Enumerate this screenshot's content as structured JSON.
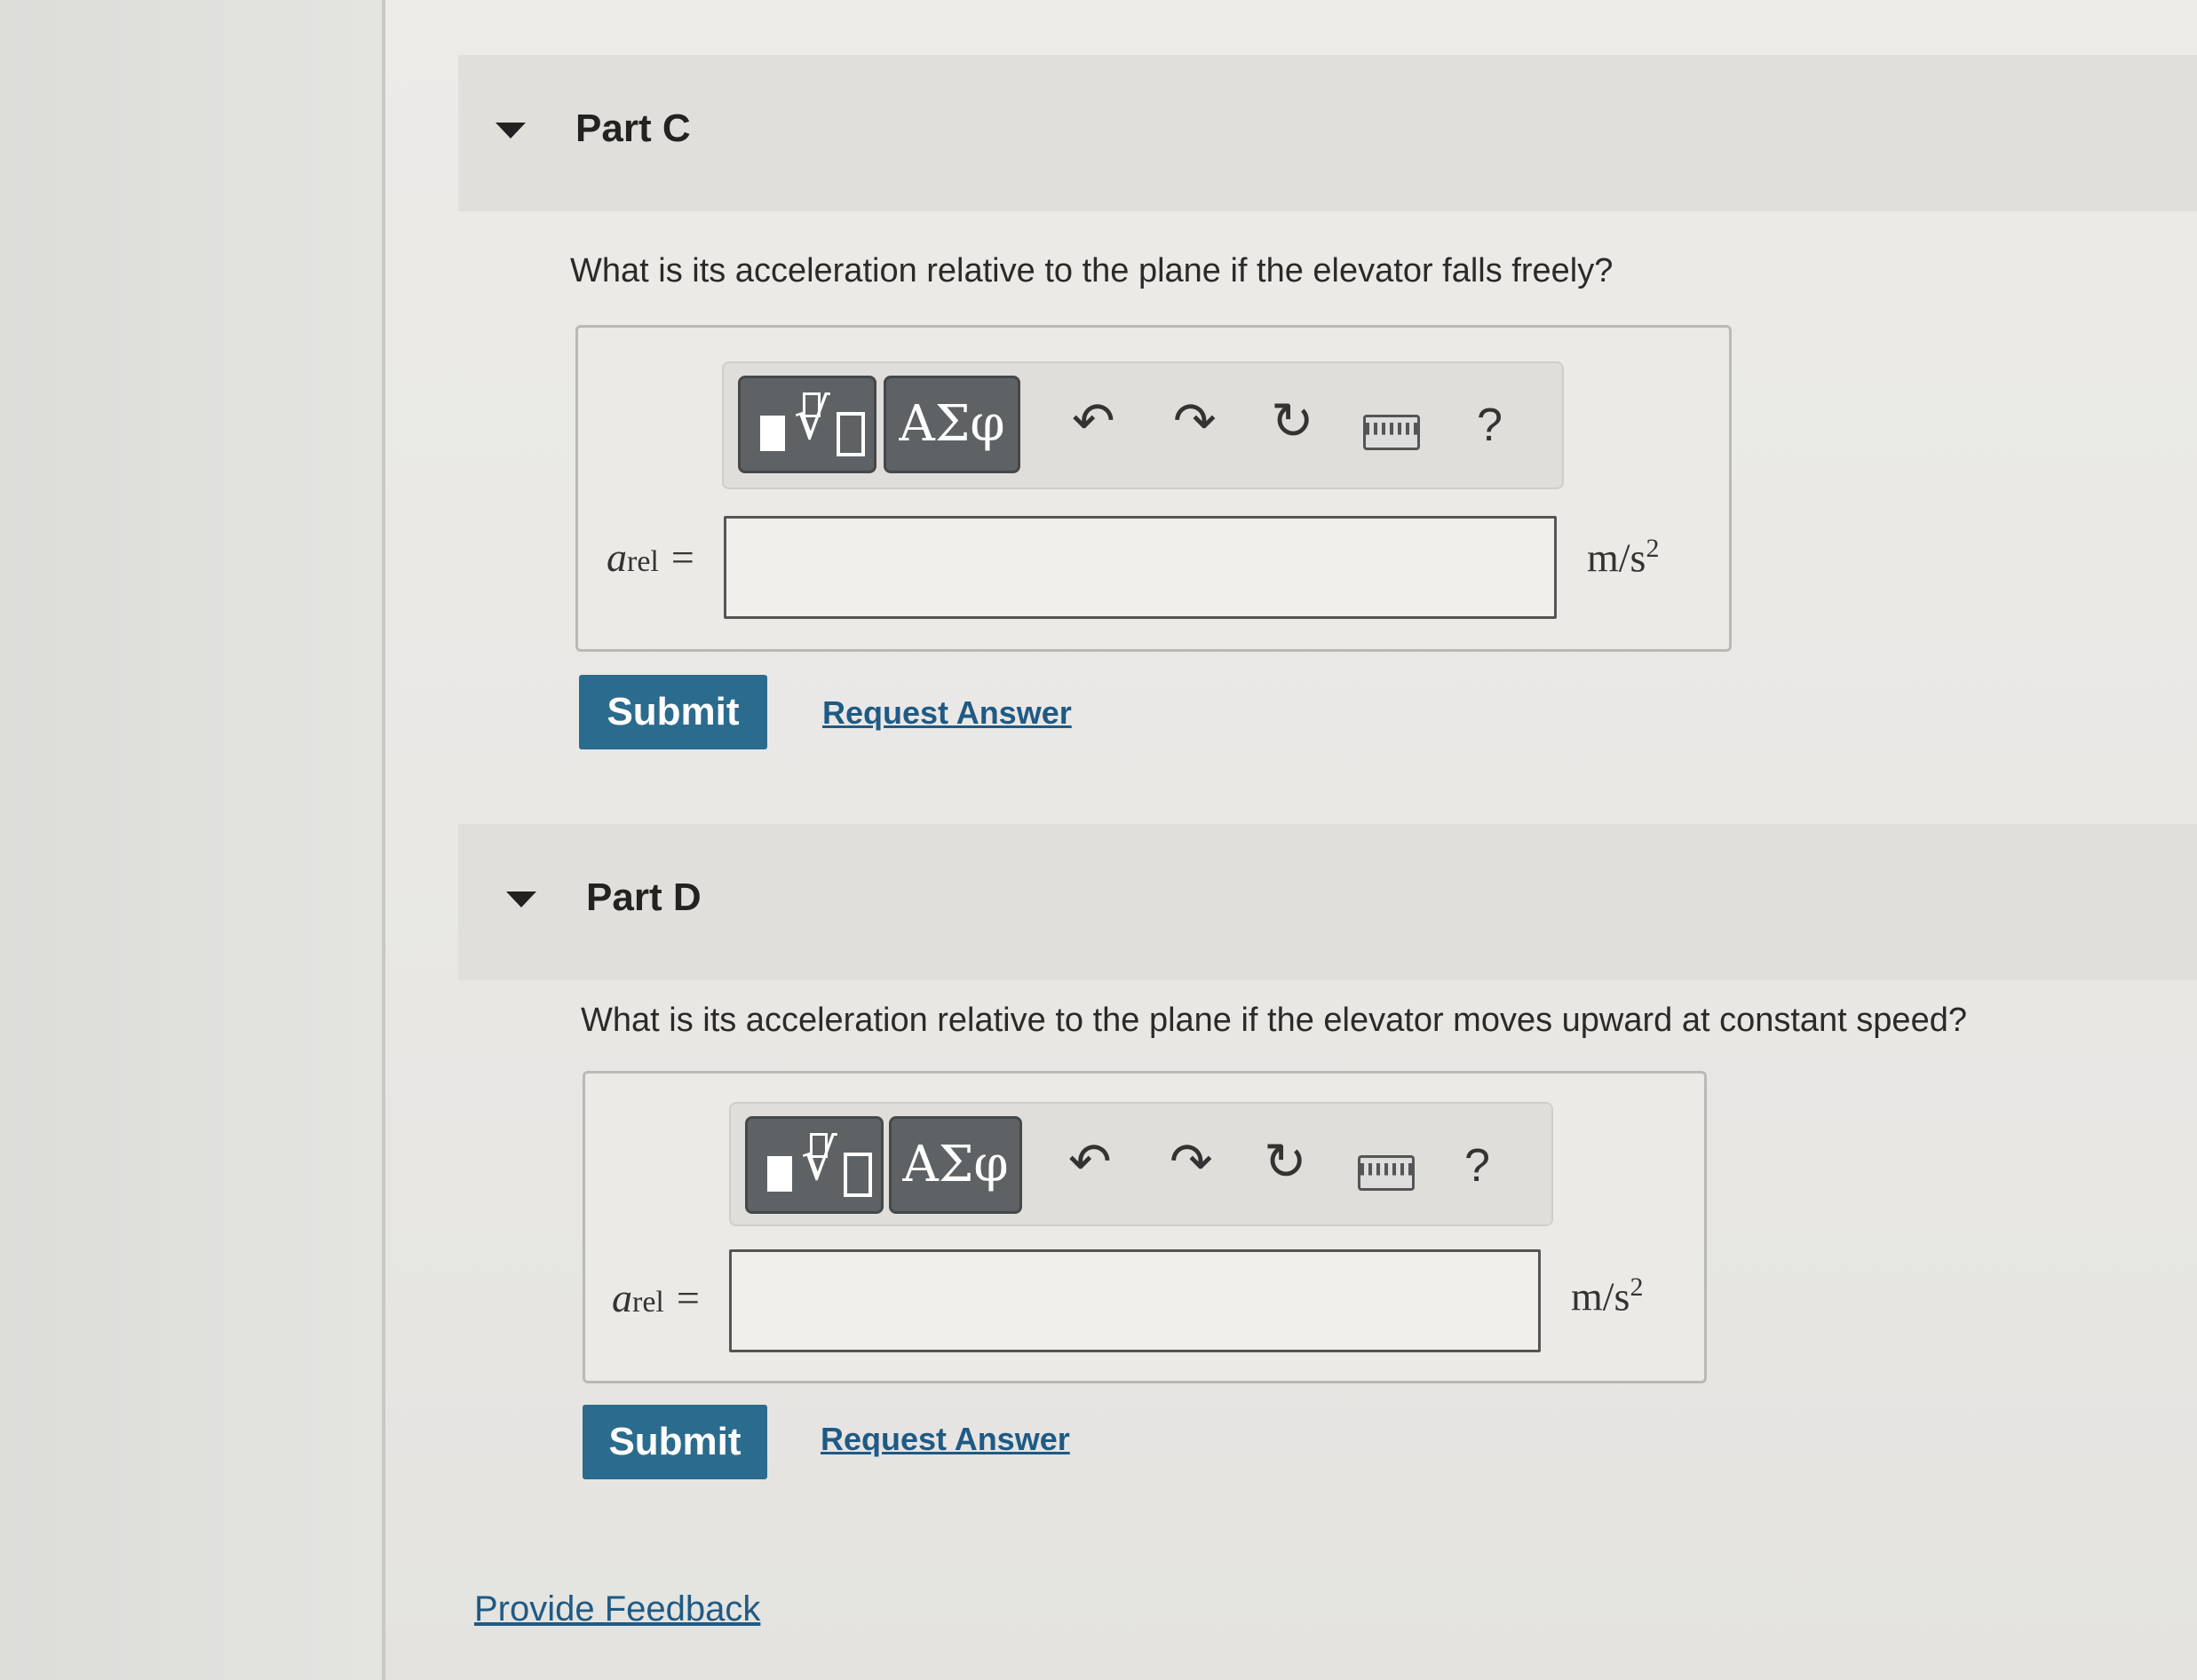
{
  "part_c": {
    "title": "Part C",
    "question": "What is its acceleration relative to the plane if the elevator falls freely?",
    "var_symbol": "a",
    "var_subscript": "rel",
    "equals": "=",
    "input_value": "",
    "unit": "m/s",
    "unit_exp": "2",
    "submit_label": "Submit",
    "request_label": "Request Answer"
  },
  "part_d": {
    "title": "Part D",
    "question": "What is its acceleration relative to the plane if the elevator moves upward at constant speed?",
    "var_symbol": "a",
    "var_subscript": "rel",
    "equals": "=",
    "input_value": "",
    "unit": "m/s",
    "unit_exp": "2",
    "submit_label": "Submit",
    "request_label": "Request Answer"
  },
  "toolbar": {
    "greek_label": "ΑΣφ",
    "undo_glyph": "↶",
    "redo_glyph": "↷",
    "reset_glyph": "↻",
    "help_label": "?"
  },
  "footer": {
    "feedback_label": "Provide Feedback"
  }
}
